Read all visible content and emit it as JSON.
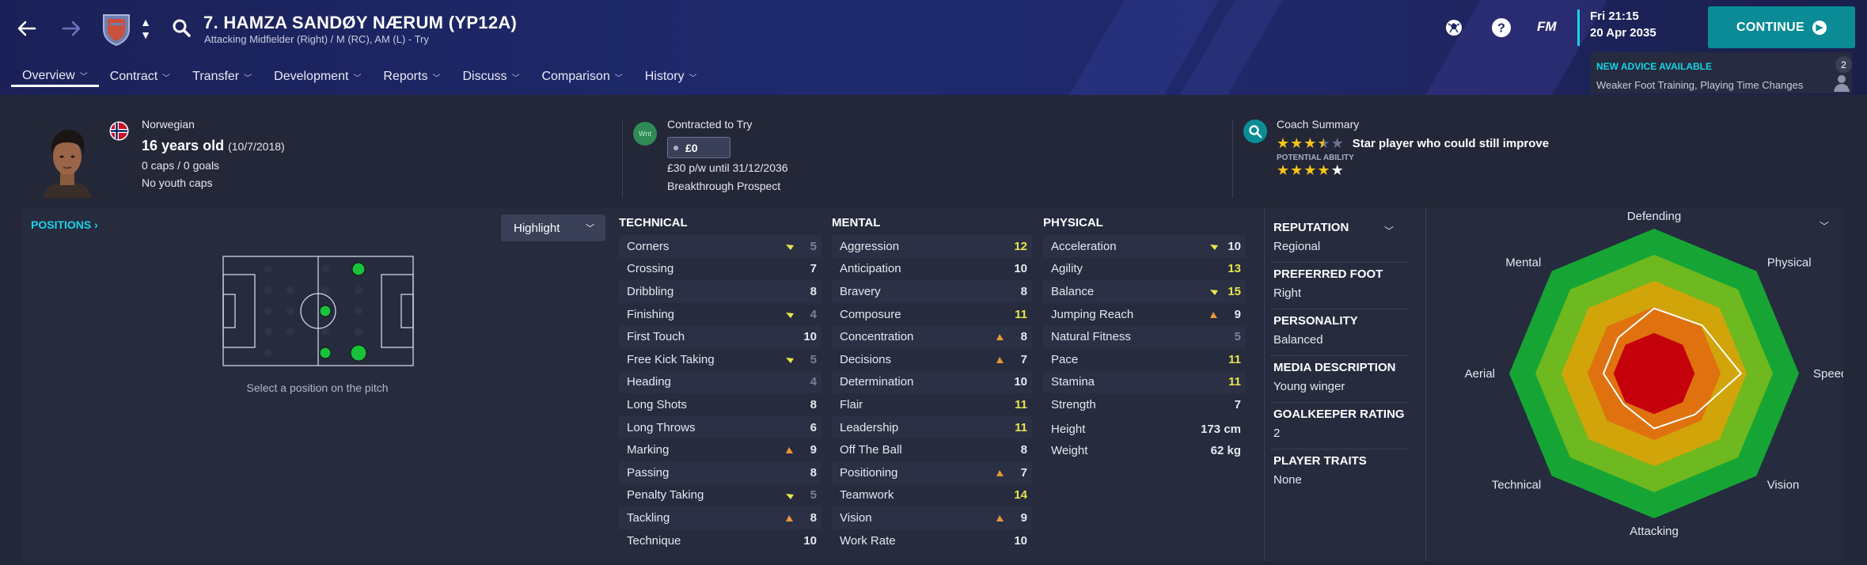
{
  "header": {
    "title": "7. HAMZA SANDØY NÆRUM (YP12A)",
    "subtitle": "Attacking Midfielder (Right) / M (RC), AM (L) - Try",
    "tabs": [
      {
        "label": "Overview"
      },
      {
        "label": "Contract"
      },
      {
        "label": "Transfer"
      },
      {
        "label": "Development"
      },
      {
        "label": "Reports"
      },
      {
        "label": "Discuss"
      },
      {
        "label": "Comparison"
      },
      {
        "label": "History"
      }
    ],
    "logo_text": "FM",
    "time": "Fri 21:15",
    "date": "20 Apr 2035",
    "continue_label": "CONTINUE",
    "advice_title": "NEW ADVICE AVAILABLE",
    "advice_text": "Weaker Foot Training, Playing Time Changes",
    "advice_count": "2",
    "accent_color": "#19d3e6",
    "continue_color": "#0a8b96"
  },
  "player": {
    "nationality": "Norwegian",
    "age": "16 years old",
    "dob": "(10/7/2018)",
    "caps": "0 caps / 0 goals",
    "youth_caps": "No youth caps"
  },
  "contract": {
    "badge": "Wnt",
    "type": "Contracted to Try",
    "value": "£0",
    "wage": "£30 p/w until 31/12/2036",
    "prospect": "Breakthrough Prospect"
  },
  "coach": {
    "title": "Coach Summary",
    "ability_stars": 3.5,
    "summary": "Star player who could still improve",
    "potential_label": "POTENTIAL ABILITY",
    "potential_stars": 5
  },
  "positions": {
    "heading": "POSITIONS ›",
    "highlight_label": "Highlight",
    "hint": "Select a position on the pitch"
  },
  "technical": {
    "heading": "TECHNICAL",
    "attrs": [
      {
        "name": "Corners",
        "value": "5",
        "trend": "down"
      },
      {
        "name": "Crossing",
        "value": "7",
        "trend": ""
      },
      {
        "name": "Dribbling",
        "value": "8",
        "trend": ""
      },
      {
        "name": "Finishing",
        "value": "4",
        "trend": "down"
      },
      {
        "name": "First Touch",
        "value": "10",
        "trend": ""
      },
      {
        "name": "Free Kick Taking",
        "value": "5",
        "trend": "down"
      },
      {
        "name": "Heading",
        "value": "4",
        "trend": ""
      },
      {
        "name": "Long Shots",
        "value": "8",
        "trend": ""
      },
      {
        "name": "Long Throws",
        "value": "6",
        "trend": ""
      },
      {
        "name": "Marking",
        "value": "9",
        "trend": "up"
      },
      {
        "name": "Passing",
        "value": "8",
        "trend": ""
      },
      {
        "name": "Penalty Taking",
        "value": "5",
        "trend": "down"
      },
      {
        "name": "Tackling",
        "value": "8",
        "trend": "up"
      },
      {
        "name": "Technique",
        "value": "10",
        "trend": ""
      }
    ]
  },
  "mental": {
    "heading": "MENTAL",
    "attrs": [
      {
        "name": "Aggression",
        "value": "12",
        "trend": ""
      },
      {
        "name": "Anticipation",
        "value": "10",
        "trend": ""
      },
      {
        "name": "Bravery",
        "value": "8",
        "trend": ""
      },
      {
        "name": "Composure",
        "value": "11",
        "trend": ""
      },
      {
        "name": "Concentration",
        "value": "8",
        "trend": "up"
      },
      {
        "name": "Decisions",
        "value": "7",
        "trend": "up"
      },
      {
        "name": "Determination",
        "value": "10",
        "trend": ""
      },
      {
        "name": "Flair",
        "value": "11",
        "trend": ""
      },
      {
        "name": "Leadership",
        "value": "11",
        "trend": ""
      },
      {
        "name": "Off The Ball",
        "value": "8",
        "trend": ""
      },
      {
        "name": "Positioning",
        "value": "7",
        "trend": "up"
      },
      {
        "name": "Teamwork",
        "value": "14",
        "trend": ""
      },
      {
        "name": "Vision",
        "value": "9",
        "trend": "up"
      },
      {
        "name": "Work Rate",
        "value": "10",
        "trend": ""
      }
    ]
  },
  "physical": {
    "heading": "PHYSICAL",
    "attrs": [
      {
        "name": "Acceleration",
        "value": "10",
        "trend": "down"
      },
      {
        "name": "Agility",
        "value": "13",
        "trend": ""
      },
      {
        "name": "Balance",
        "value": "15",
        "trend": "down"
      },
      {
        "name": "Jumping Reach",
        "value": "9",
        "trend": "up"
      },
      {
        "name": "Natural Fitness",
        "value": "5",
        "trend": ""
      },
      {
        "name": "Pace",
        "value": "11",
        "trend": ""
      },
      {
        "name": "Stamina",
        "value": "11",
        "trend": ""
      },
      {
        "name": "Strength",
        "value": "7",
        "trend": ""
      }
    ],
    "height_label": "Height",
    "height": "173 cm",
    "weight_label": "Weight",
    "weight": "62 kg"
  },
  "info": [
    {
      "key": "REPUTATION",
      "value": "Regional"
    },
    {
      "key": "PREFERRED FOOT",
      "value": "Right"
    },
    {
      "key": "PERSONALITY",
      "value": "Balanced"
    },
    {
      "key": "MEDIA DESCRIPTION",
      "value": "Young winger"
    },
    {
      "key": "GOALKEEPER RATING",
      "value": "2"
    },
    {
      "key": "PLAYER TRAITS",
      "value": "None"
    }
  ],
  "radar": {
    "labels": [
      "Defending",
      "Physical",
      "Speed",
      "Vision",
      "Attacking",
      "Technical",
      "Aerial",
      "Mental"
    ],
    "values": [
      0.45,
      0.47,
      0.6,
      0.4,
      0.38,
      0.3,
      0.35,
      0.35
    ]
  }
}
